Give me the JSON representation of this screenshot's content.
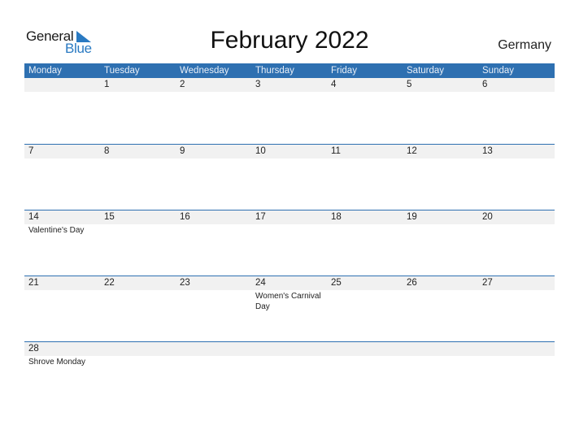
{
  "brand": {
    "line1": "General",
    "line2": "Blue",
    "accent": "#2a7ac2"
  },
  "title": "February 2022",
  "country": "Germany",
  "header_color": "#2e70b1",
  "weekdays": [
    "Monday",
    "Tuesday",
    "Wednesday",
    "Thursday",
    "Friday",
    "Saturday",
    "Sunday"
  ],
  "weeks": [
    {
      "days": [
        "",
        "1",
        "2",
        "3",
        "4",
        "5",
        "6"
      ],
      "events": [
        "",
        "",
        "",
        "",
        "",
        "",
        ""
      ]
    },
    {
      "days": [
        "7",
        "8",
        "9",
        "10",
        "11",
        "12",
        "13"
      ],
      "events": [
        "",
        "",
        "",
        "",
        "",
        "",
        ""
      ]
    },
    {
      "days": [
        "14",
        "15",
        "16",
        "17",
        "18",
        "19",
        "20"
      ],
      "events": [
        "Valentine's Day",
        "",
        "",
        "",
        "",
        "",
        ""
      ]
    },
    {
      "days": [
        "21",
        "22",
        "23",
        "24",
        "25",
        "26",
        "27"
      ],
      "events": [
        "",
        "",
        "",
        "Women's Carnival Day",
        "",
        "",
        ""
      ]
    },
    {
      "days": [
        "28",
        "",
        "",
        "",
        "",
        "",
        ""
      ],
      "events": [
        "Shrove Monday",
        "",
        "",
        "",
        "",
        "",
        ""
      ]
    }
  ]
}
